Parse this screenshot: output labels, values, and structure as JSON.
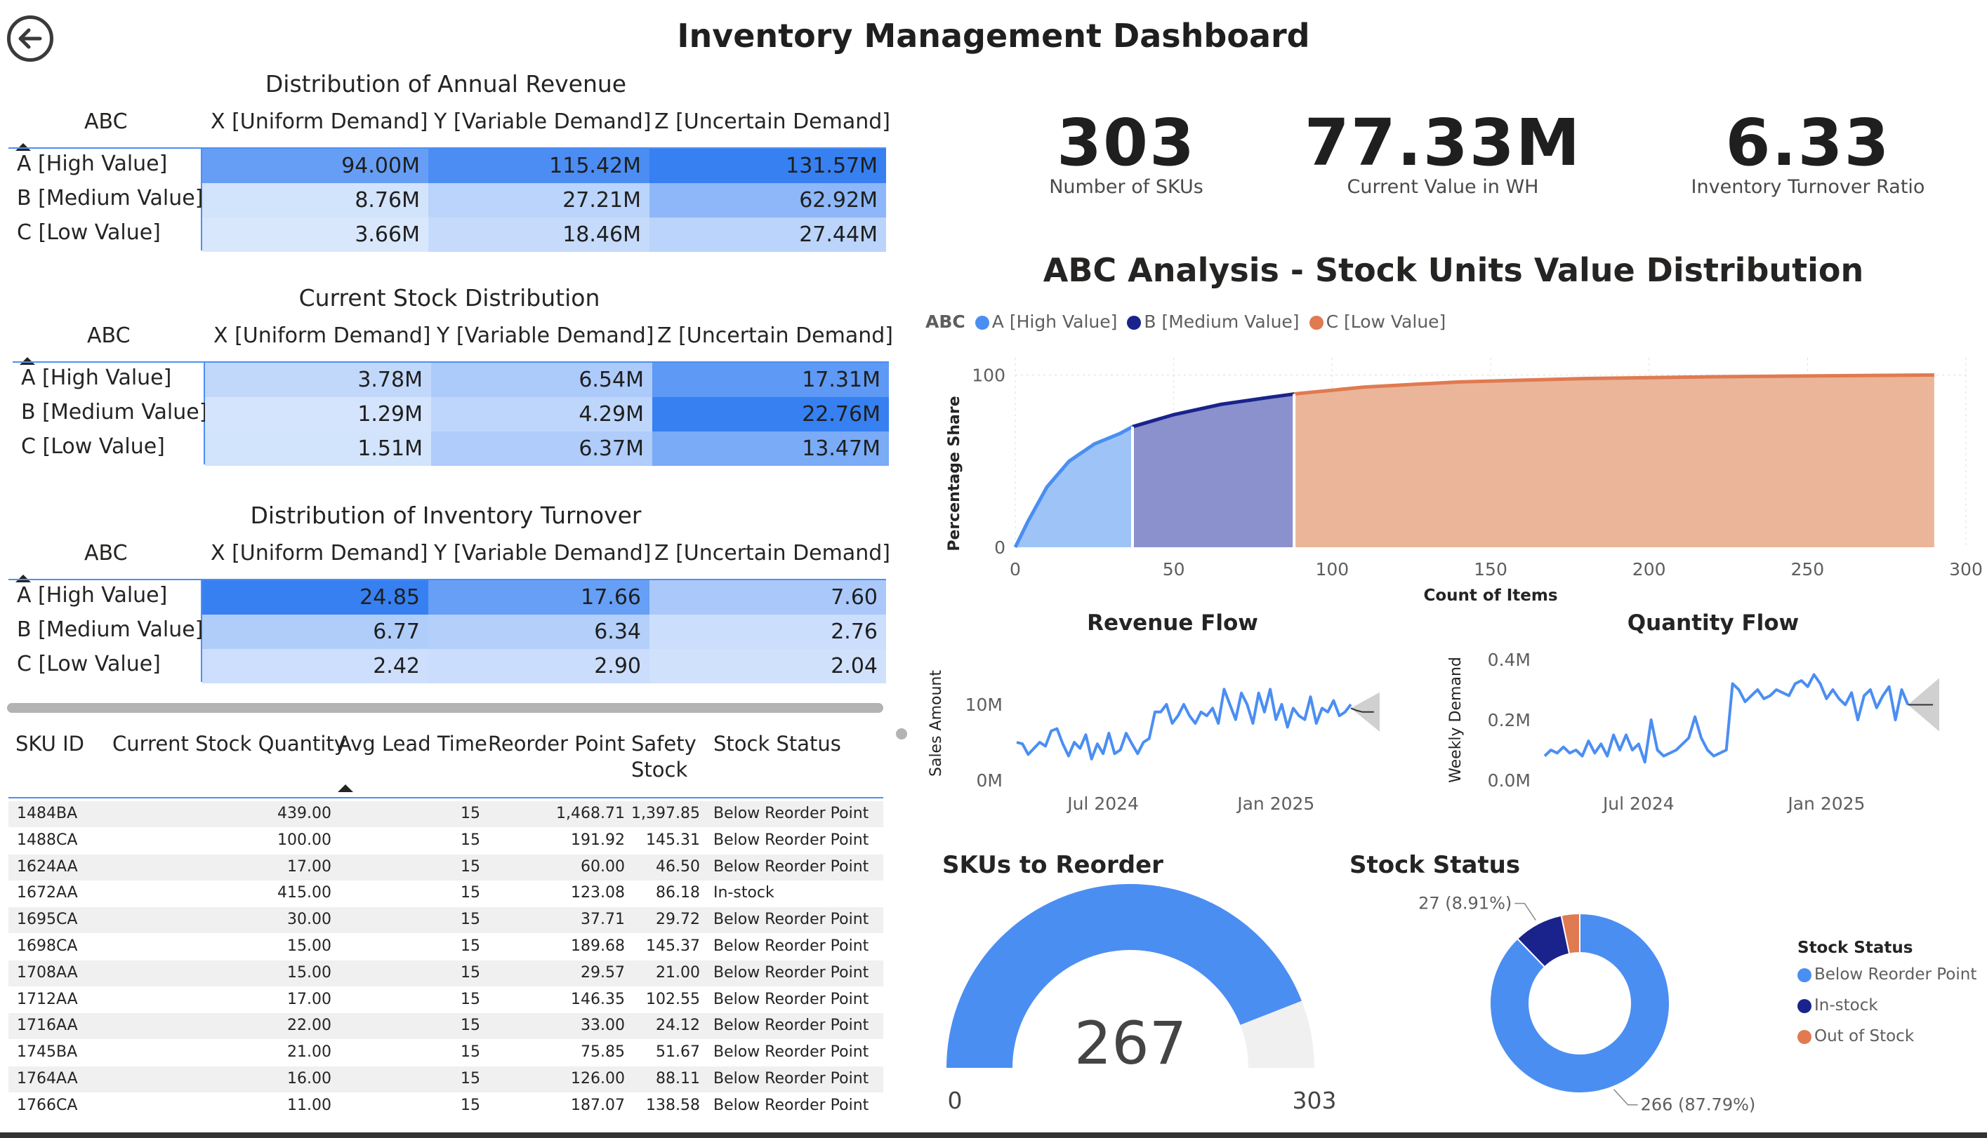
{
  "title": "Inventory Management Dashboard",
  "colors": {
    "accent": "#4b8ef2",
    "navy": "#1a238c",
    "orange": "#e07a50",
    "grey": "#f0f0f0"
  },
  "matrix_headers": {
    "row": "ABC",
    "x": "X [Uniform Demand]",
    "y": "Y [Variable Demand]",
    "z": "Z [Uncertain Demand]"
  },
  "rows": [
    "A [High Value]",
    "B [Medium Value]",
    "C [Low Value]"
  ],
  "revenue": {
    "title": "Distribution of Annual Revenue",
    "cells": [
      [
        "94.00M",
        "115.42M",
        "131.57M"
      ],
      [
        "8.76M",
        "27.21M",
        "62.92M"
      ],
      [
        "3.66M",
        "18.46M",
        "27.44M"
      ]
    ],
    "values": [
      [
        94.0,
        115.42,
        131.57
      ],
      [
        8.76,
        27.21,
        62.92
      ],
      [
        3.66,
        18.46,
        27.44
      ]
    ]
  },
  "stock": {
    "title": "Current Stock Distribution",
    "cells": [
      [
        "3.78M",
        "6.54M",
        "17.31M"
      ],
      [
        "1.29M",
        "4.29M",
        "22.76M"
      ],
      [
        "1.51M",
        "6.37M",
        "13.47M"
      ]
    ],
    "values": [
      [
        3.78,
        6.54,
        17.31
      ],
      [
        1.29,
        4.29,
        22.76
      ],
      [
        1.51,
        6.37,
        13.47
      ]
    ]
  },
  "turnover": {
    "title": "Distribution of Inventory Turnover",
    "cells": [
      [
        "24.85",
        "17.66",
        "7.60"
      ],
      [
        "6.77",
        "6.34",
        "2.76"
      ],
      [
        "2.42",
        "2.90",
        "2.04"
      ]
    ],
    "values": [
      [
        24.85,
        17.66,
        7.6
      ],
      [
        6.77,
        6.34,
        2.76
      ],
      [
        2.42,
        2.9,
        2.04
      ]
    ]
  },
  "kpis": [
    {
      "value": "303",
      "label": "Number of SKUs"
    },
    {
      "value": "77.33M",
      "label": "Current Value in WH"
    },
    {
      "value": "6.33",
      "label": "Inventory Turnover Ratio"
    }
  ],
  "sku_table": {
    "headers": [
      "SKU ID",
      "Current Stock Quantity",
      "Avg Lead Time",
      "Reorder Point",
      "Safety",
      "Stock",
      "Stock Status"
    ],
    "rows": [
      [
        "1484BA",
        "439.00",
        "15",
        "1,468.71",
        "1,397.85",
        "Below Reorder Point"
      ],
      [
        "1488CA",
        "100.00",
        "15",
        "191.92",
        "145.31",
        "Below Reorder Point"
      ],
      [
        "1624AA",
        "17.00",
        "15",
        "60.00",
        "46.50",
        "Below Reorder Point"
      ],
      [
        "1672AA",
        "415.00",
        "15",
        "123.08",
        "86.18",
        "In-stock"
      ],
      [
        "1695CA",
        "30.00",
        "15",
        "37.71",
        "29.72",
        "Below Reorder Point"
      ],
      [
        "1698CA",
        "15.00",
        "15",
        "189.68",
        "145.37",
        "Below Reorder Point"
      ],
      [
        "1708AA",
        "15.00",
        "15",
        "29.57",
        "21.00",
        "Below Reorder Point"
      ],
      [
        "1712AA",
        "17.00",
        "15",
        "146.35",
        "102.55",
        "Below Reorder Point"
      ],
      [
        "1716AA",
        "22.00",
        "15",
        "33.00",
        "24.12",
        "Below Reorder Point"
      ],
      [
        "1745BA",
        "21.00",
        "15",
        "75.85",
        "51.67",
        "Below Reorder Point"
      ],
      [
        "1764AA",
        "16.00",
        "15",
        "126.00",
        "88.11",
        "Below Reorder Point"
      ],
      [
        "1766CA",
        "11.00",
        "15",
        "187.07",
        "138.58",
        "Below Reorder Point"
      ]
    ]
  },
  "chart_data": [
    {
      "type": "area",
      "title": "ABC Analysis - Stock Units Value Distribution",
      "legend_title": "ABC",
      "legend_position": "top-left",
      "xlabel": "Count of Items",
      "ylabel": "Percentage Share",
      "xlim": [
        0,
        300
      ],
      "ylim": [
        0,
        110
      ],
      "xticks": [
        "0",
        "50",
        "100",
        "150",
        "200",
        "250",
        "300"
      ],
      "yticks": [
        "0",
        "100"
      ],
      "series": [
        {
          "name": "A [High Value]",
          "color": "#4b8ef2",
          "x": [
            0,
            4,
            10,
            17,
            25,
            33,
            37
          ],
          "y": [
            0,
            15,
            35,
            50,
            60,
            66,
            70
          ]
        },
        {
          "name": "B [Medium Value]",
          "color": "#1a238c",
          "x": [
            37,
            50,
            65,
            80,
            88
          ],
          "y": [
            70,
            77,
            83,
            87,
            89
          ]
        },
        {
          "name": "C [Low Value]",
          "color": "#e07a50",
          "x": [
            88,
            110,
            140,
            180,
            220,
            260,
            290
          ],
          "y": [
            89,
            93,
            96,
            98,
            99,
            99.6,
            100
          ]
        }
      ]
    },
    {
      "type": "line",
      "title": "Revenue Flow",
      "ylabel": "Sales Amount",
      "xtick_labels": [
        "Jul 2024",
        "Jan 2025"
      ],
      "yticks": [
        "0M",
        "10M"
      ],
      "ylim": [
        0,
        15
      ],
      "x_ticks_at": [
        15,
        45
      ],
      "forecast_start": 58,
      "values": [
        5,
        4.8,
        3.4,
        4.2,
        5,
        4.5,
        6.5,
        6.8,
        4.8,
        3.2,
        5,
        4.2,
        6,
        2.8,
        4.8,
        3.5,
        6.2,
        3.5,
        4,
        6.2,
        4.8,
        3.5,
        5,
        5.5,
        9,
        9,
        10,
        7.5,
        8.5,
        10,
        8.5,
        7.5,
        9,
        8.5,
        9.5,
        7.5,
        12,
        10,
        8,
        11.5,
        10,
        7.5,
        11.5,
        9,
        12,
        8,
        10,
        7,
        9.5,
        8.5,
        8,
        11,
        7.5,
        9.5,
        9,
        10.5,
        8.5,
        9,
        10
      ],
      "forecast_values": [
        9.5,
        9.2,
        9.0,
        9.0,
        9.0
      ],
      "color": "#4b8ef2"
    },
    {
      "type": "line",
      "title": "Quantity Flow",
      "ylabel": "Weekly Demand",
      "xtick_labels": [
        "Jul 2024",
        "Jan 2025"
      ],
      "yticks": [
        "0.0M",
        "0.2M",
        "0.4M"
      ],
      "ylim": [
        0,
        0.4
      ],
      "x_ticks_at": [
        15,
        45
      ],
      "forecast_start": 58,
      "values": [
        0.08,
        0.1,
        0.09,
        0.11,
        0.09,
        0.1,
        0.08,
        0.13,
        0.09,
        0.12,
        0.08,
        0.15,
        0.1,
        0.15,
        0.1,
        0.12,
        0.06,
        0.2,
        0.1,
        0.08,
        0.09,
        0.1,
        0.12,
        0.14,
        0.21,
        0.14,
        0.1,
        0.08,
        0.09,
        0.1,
        0.32,
        0.3,
        0.26,
        0.28,
        0.3,
        0.27,
        0.28,
        0.3,
        0.29,
        0.28,
        0.32,
        0.33,
        0.31,
        0.35,
        0.32,
        0.27,
        0.3,
        0.27,
        0.25,
        0.29,
        0.2,
        0.28,
        0.3,
        0.24,
        0.28,
        0.31,
        0.2,
        0.3,
        0.25
      ],
      "forecast_values": [
        0.25,
        0.25,
        0.25,
        0.25,
        0.25
      ],
      "color": "#4b8ef2"
    },
    {
      "type": "gauge",
      "title": "SKUs to Reorder",
      "value": 267,
      "min": 0,
      "max": 303,
      "value_label": "267",
      "min_label": "0",
      "max_label": "303"
    },
    {
      "type": "pie",
      "title": "Stock Status",
      "legend_title": "Stock Status",
      "legend_position": "right",
      "slices": [
        {
          "name": "Below Reorder Point",
          "value": 266,
          "color": "#4b8ef2",
          "label": "266 (87.79%)"
        },
        {
          "name": "In-stock",
          "value": 27,
          "color": "#1a238c",
          "label": "27 (8.91%)"
        },
        {
          "name": "Out of Stock",
          "value": 10,
          "color": "#e07a50",
          "label": ""
        }
      ]
    }
  ]
}
